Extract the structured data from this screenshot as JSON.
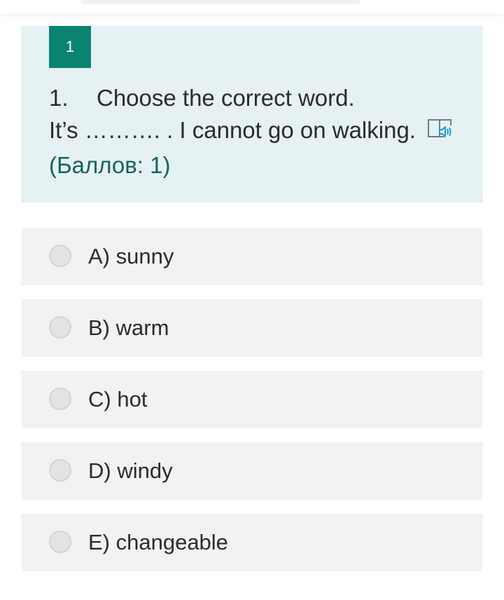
{
  "question": {
    "badge": "1",
    "number": "1.",
    "prompt": "Choose the correct word.",
    "sentence": "It’s ………. . I cannot go on walking.",
    "points": "(Баллов: 1)",
    "icon": "immersive-reader-speaker-icon",
    "accent_color": "#0b8472",
    "card_color": "#e6f1f3"
  },
  "options": [
    {
      "label": "A) sunny",
      "selected": false
    },
    {
      "label": "B) warm",
      "selected": false
    },
    {
      "label": "C) hot",
      "selected": false
    },
    {
      "label": "D) windy",
      "selected": false
    },
    {
      "label": "E) changeable",
      "selected": false
    }
  ]
}
